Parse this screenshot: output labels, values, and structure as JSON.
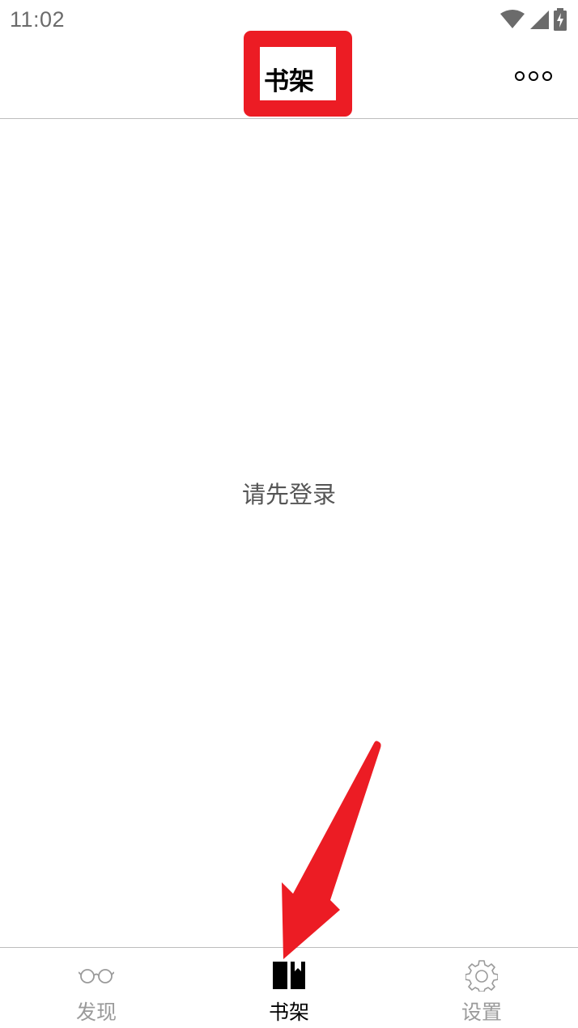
{
  "status_bar": {
    "time": "11:02",
    "icons": [
      "wifi-icon",
      "cellular-signal-icon",
      "battery-charging-icon"
    ]
  },
  "header": {
    "title": "书架",
    "more_icon": "more-dots-icon"
  },
  "main": {
    "message": "请先登录"
  },
  "tab_bar": {
    "tabs": [
      {
        "label": "发现",
        "icon": "glasses-icon",
        "active": false
      },
      {
        "label": "书架",
        "icon": "book-icon",
        "active": true
      },
      {
        "label": "设置",
        "icon": "gear-icon",
        "active": false
      }
    ]
  },
  "annotations": {
    "highlight_color": "#ec1c24",
    "arrow_color": "#ec1c24"
  },
  "colors": {
    "active_tab": "#000000",
    "inactive_tab": "#9a9a9a",
    "divider": "#bdbdbd"
  }
}
